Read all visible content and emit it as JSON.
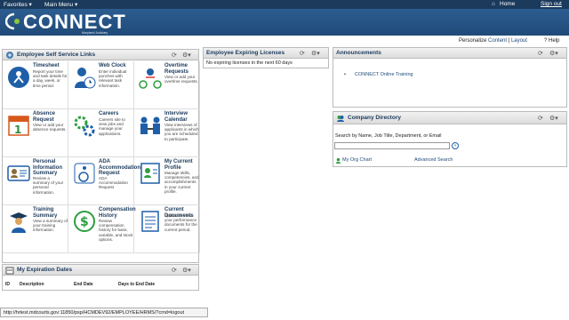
{
  "topbar": {
    "favorites": "Favorites ▾",
    "main_menu": "Main Menu ▾",
    "home": "Home",
    "sign_out": "Sign out"
  },
  "banner": {
    "logo": "CONNECT",
    "subtitle": "Maryland Judiciary"
  },
  "personalize": {
    "label": "Personalize",
    "content": "Content",
    "sep": "|",
    "layout": "Layout"
  },
  "help": "Help",
  "ess": {
    "title": "Employee Self Service Links",
    "tiles": [
      {
        "title": "Timesheet",
        "desc": "Report your time and task details for a day, week, or time period."
      },
      {
        "title": "Web Clock",
        "desc": "Enter individual punches with relevant task information."
      },
      {
        "title": "Overtime Requests",
        "desc": "View or add your overtime requests."
      },
      {
        "title": "Absence Request",
        "desc": "View or add your absence requests."
      },
      {
        "title": "Careers",
        "desc": "Careers site to view jobs and manage your applications."
      },
      {
        "title": "Interview Calendar",
        "desc": "View interviews of applicants in which you are scheduled to participate."
      },
      {
        "title": "Personal Information Summary",
        "desc": "Review a summary of your personal information."
      },
      {
        "title": "ADA Accommodation Request",
        "desc": "ADA Accommodation Request"
      },
      {
        "title": "My Current Profile",
        "desc": "Manage skills, competencies, and accomplishments in your current profile."
      },
      {
        "title": "Training Summary",
        "desc": "View a summary of your training information."
      },
      {
        "title": "Compensation History",
        "desc": "Review compensation history for base, variable, and stock options."
      },
      {
        "title": "Current Documents",
        "desc": "Update or view your performance documents for the current period."
      }
    ]
  },
  "expiring": {
    "title": "Employee Expiring Licenses",
    "message": "No expiring licenses in the next 60 days"
  },
  "announcements": {
    "title": "Announcements",
    "item": "CONNECT Online Training"
  },
  "directory": {
    "title": "Company Directory",
    "search_label": "Search by Name, Job Title, Department, or Email",
    "org_chart": "My Org Chart",
    "advanced": "Advanced Search"
  },
  "expiration": {
    "title": "My Expiration Dates",
    "columns": [
      "ID",
      "Description",
      "End Date",
      "Days to End Date"
    ]
  },
  "status_url": "http://hrtest.mdcourts.gov:11850/psp/HCMDEV92/EMPLOYEE/HRMS/?cmd=logout",
  "colors": {
    "banner": "#1f4a78",
    "topbar": "#1b3a5c"
  }
}
